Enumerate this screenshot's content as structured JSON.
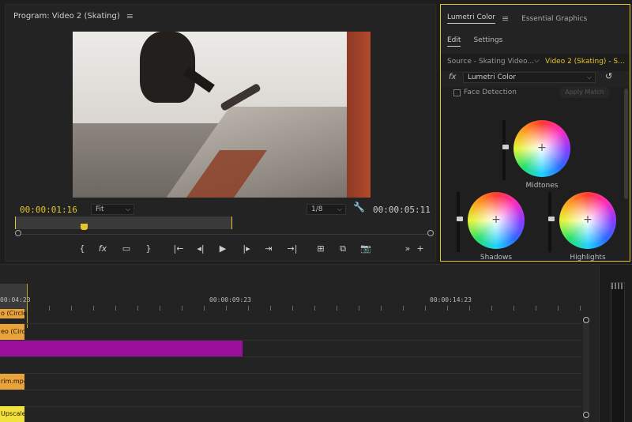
{
  "program": {
    "title": "Program: Video 2 (Skating)",
    "menu_icon": "hamburger-icon",
    "timecode_current": "00:00:01:16",
    "fit": "Fit",
    "resolution": "1/8",
    "timecode_duration": "00:00:05:11",
    "transport_icons": [
      "mark-in-icon",
      "fx-icon",
      "safe-margins-icon",
      "mark-out-icon",
      "go-to-in-icon",
      "step-back-icon",
      "play-icon",
      "step-forward-icon",
      "export-frame-icon",
      "go-to-out-icon",
      "lift-icon",
      "extract-icon",
      "camera-icon",
      "more-icon",
      "add-icon"
    ]
  },
  "lumetri": {
    "tab_active": "Lumetri Color",
    "tab_other": "Essential Graphics",
    "subtab_edit": "Edit",
    "subtab_settings": "Settings",
    "source": "Source - Skating Video...",
    "target": "Video 2 (Skating) - S...",
    "fx": "fx",
    "effect": "Lumetri Color",
    "face_detection": "Face Detection",
    "apply_match": "Apply Match",
    "wheels": {
      "midtones": "Midtones",
      "shadows": "Shadows",
      "highlights": "Highlights"
    },
    "border_color": "#e4c52a"
  },
  "timeline": {
    "tc_1": "00:04:23",
    "tc_2": "00:00:09:23",
    "tc_3": "00:00:14:23",
    "clips": [
      {
        "label": "o (Circle)",
        "color": "#e8a33c"
      },
      {
        "label": "eo (Circle)",
        "color": "#e8a33c"
      },
      {
        "label": "",
        "color": "#9b0f9b"
      },
      {
        "label": "rim.mp4",
        "color": "#e8a33c"
      },
      {
        "label": "Upscaled.",
        "color": "#f2e23d"
      }
    ]
  }
}
